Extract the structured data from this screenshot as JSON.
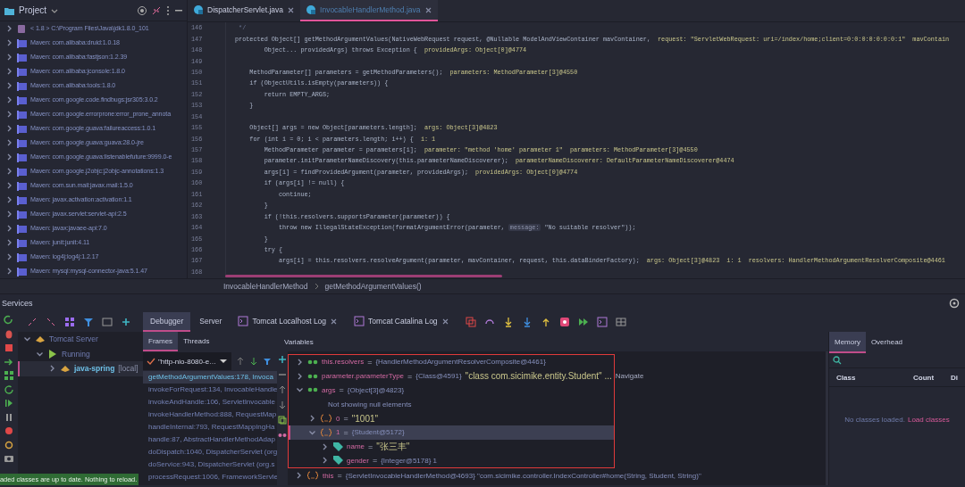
{
  "project": {
    "title": "Project",
    "items": [
      {
        "label": "< 1.8 > C:\\Program Files\\Java\\jdk1.8.0_101",
        "kind": "sdk",
        "expanded": false
      },
      {
        "label": "Maven: com.alibaba:druid:1.0.18",
        "kind": "library",
        "expanded": false
      },
      {
        "label": "Maven: com.alibaba:fastjson:1.2.39",
        "kind": "library",
        "expanded": false
      },
      {
        "label": "Maven: com.alibaba:jconsole:1.8.0",
        "kind": "library",
        "expanded": false
      },
      {
        "label": "Maven: com.alibaba:tools:1.8.0",
        "kind": "library",
        "expanded": false
      },
      {
        "label": "Maven: com.google.code.findbugs:jsr305:3.0.2",
        "kind": "library",
        "expanded": false
      },
      {
        "label": "Maven: com.google.errorprone:error_prone_annota",
        "kind": "library",
        "expanded": false
      },
      {
        "label": "Maven: com.google.guava:failureaccess:1.0.1",
        "kind": "library",
        "expanded": false
      },
      {
        "label": "Maven: com.google.guava:guava:28.0-jre",
        "kind": "library",
        "expanded": false
      },
      {
        "label": "Maven: com.google.guava:listenablefuture:9999.0-e",
        "kind": "library",
        "expanded": false
      },
      {
        "label": "Maven: com.google.j2objc:j2objc-annotations:1.3",
        "kind": "library",
        "expanded": false
      },
      {
        "label": "Maven: com.sun.mail:javax.mail:1.5.0",
        "kind": "library",
        "expanded": false
      },
      {
        "label": "Maven: javax.activation:activation:1.1",
        "kind": "library",
        "expanded": false
      },
      {
        "label": "Maven: javax.servlet:servlet-api:2.5",
        "kind": "library",
        "expanded": false
      },
      {
        "label": "Maven: javax:javaee-api:7.0",
        "kind": "library",
        "expanded": false
      },
      {
        "label": "Maven: junit:junit:4.11",
        "kind": "library",
        "expanded": false
      },
      {
        "label": "Maven: log4j:log4j:1.2.17",
        "kind": "library",
        "expanded": false
      },
      {
        "label": "Maven: mysql:mysql-connector-java:5.1.47",
        "kind": "library",
        "expanded": false
      }
    ]
  },
  "editor": {
    "tabs": [
      {
        "label": "DispatcherServlet.java",
        "selected": false
      },
      {
        "label": "InvocableHandlerMethod.java",
        "selected": true
      }
    ],
    "lines": [
      {
        "number": "146",
        "parts": [
          {
            "kind": "comment",
            "text": " */"
          }
        ]
      },
      {
        "number": "147",
        "parts": [
          {
            "kind": "code",
            "text": "protected Object[] getMethodArgumentValues(NativeWebRequest request, @Nullable ModelAndViewContainer mavContainer,"
          },
          {
            "kind": "hint",
            "text": "request: \"ServletWebRequest: uri=/index/home;client=0:0:0:0:0:0:0:1\""
          },
          {
            "kind": "hint",
            "text": "mavContain"
          }
        ]
      },
      {
        "number": "148",
        "parts": [
          {
            "kind": "code",
            "text": "        Object... providedArgs) throws Exception {"
          },
          {
            "kind": "hint",
            "text": "providedArgs: Object[0]@4774"
          }
        ]
      },
      {
        "number": "149"
      },
      {
        "number": "150",
        "parts": [
          {
            "kind": "code",
            "text": "    MethodParameter[] parameters = getMethodParameters();"
          },
          {
            "kind": "hint",
            "text": "parameters: MethodParameter[3]@4550"
          }
        ]
      },
      {
        "number": "151",
        "parts": [
          {
            "kind": "code",
            "text": "    if (ObjectUtils.isEmpty(parameters)) {"
          }
        ]
      },
      {
        "number": "152",
        "parts": [
          {
            "kind": "code",
            "text": "        return EMPTY_ARGS;"
          }
        ]
      },
      {
        "number": "153",
        "parts": [
          {
            "kind": "code",
            "text": "    }"
          }
        ]
      },
      {
        "number": "154"
      },
      {
        "number": "155",
        "parts": [
          {
            "kind": "code",
            "text": "    Object[] args = new Object[parameters.length];"
          },
          {
            "kind": "hint",
            "text": "args: Object[3]@4823"
          }
        ]
      },
      {
        "number": "156",
        "parts": [
          {
            "kind": "code",
            "text": "    for (int i = 0; i < parameters.length; i++) {"
          },
          {
            "kind": "hint",
            "text": "i: 1"
          }
        ]
      },
      {
        "number": "157",
        "parts": [
          {
            "kind": "code",
            "text": "        MethodParameter parameter = parameters[i];"
          },
          {
            "kind": "hint",
            "text": "parameter: \"method 'home' parameter 1\""
          },
          {
            "kind": "hint",
            "text": "parameters: MethodParameter[3]@4550"
          }
        ]
      },
      {
        "number": "158",
        "parts": [
          {
            "kind": "code",
            "text": "        parameter.initParameterNameDiscovery(this.parameterNameDiscoverer);"
          },
          {
            "kind": "hint",
            "text": "parameterNameDiscoverer: DefaultParameterNameDiscoverer@4474"
          }
        ]
      },
      {
        "number": "159",
        "parts": [
          {
            "kind": "code",
            "text": "        args[i] = findProvidedArgument(parameter, providedArgs);"
          },
          {
            "kind": "hint",
            "text": "providedArgs: Object[0]@4774"
          }
        ]
      },
      {
        "number": "160",
        "parts": [
          {
            "kind": "code",
            "text": "        if (args[i] != null) {"
          }
        ]
      },
      {
        "number": "161",
        "parts": [
          {
            "kind": "code",
            "text": "            continue;"
          }
        ]
      },
      {
        "number": "162",
        "parts": [
          {
            "kind": "code",
            "text": "        }"
          }
        ]
      },
      {
        "number": "163",
        "parts": [
          {
            "kind": "code",
            "text": "        if (!this.resolvers.supportsParameter(parameter)) {"
          }
        ]
      },
      {
        "number": "164",
        "parts": [
          {
            "kind": "code",
            "text": "            throw new IllegalStateException(formatArgumentError(parameter,"
          },
          {
            "kind": "param",
            "text": "message:"
          },
          {
            "kind": "code",
            "text": "\"No suitable resolver\"));"
          }
        ]
      },
      {
        "number": "165",
        "parts": [
          {
            "kind": "code",
            "text": "        }"
          }
        ]
      },
      {
        "number": "166",
        "parts": [
          {
            "kind": "code",
            "text": "        try {"
          }
        ]
      },
      {
        "number": "167",
        "parts": [
          {
            "kind": "code",
            "text": "            args[i] = this.resolvers.resolveArgument(parameter, mavContainer, request, this.dataBinderFactory);"
          },
          {
            "kind": "hint",
            "text": "args: Object[3]@4823"
          },
          {
            "kind": "hint",
            "text": "i: 1"
          },
          {
            "kind": "hint",
            "text": "resolvers: HandlerMethodArgumentResolverComposite@4461"
          }
        ]
      },
      {
        "number": "168"
      }
    ],
    "breadcrumb": [
      "InvocableHandlerMethod",
      "getMethodArgumentValues()"
    ]
  },
  "services": {
    "title": "Services",
    "tree": [
      {
        "label": "Tomcat Server",
        "kind": "server",
        "expanded": true,
        "selected": false,
        "children": [
          {
            "label": "Running",
            "kind": "status",
            "expanded": true,
            "selected": false,
            "children": [
              {
                "label": "java-spring",
                "suffix": "[local]",
                "kind": "app",
                "expanded": false,
                "selected": true
              }
            ]
          }
        ]
      }
    ]
  },
  "debugger": {
    "tabs": [
      {
        "label": "Debugger",
        "selected": true,
        "closable": false,
        "kind": "plain"
      },
      {
        "label": "Server",
        "selected": false,
        "closable": false,
        "kind": "plain"
      },
      {
        "label": "Tomcat Localhost Log",
        "selected": false,
        "closable": true,
        "kind": "log"
      },
      {
        "label": "Tomcat Catalina Log",
        "selected": false,
        "closable": true,
        "kind": "log"
      }
    ],
    "subtabs": [
      {
        "label": "Frames",
        "selected": true
      },
      {
        "label": "Threads",
        "selected": false
      }
    ],
    "variables_title": "Variables",
    "thread": "\"http-nio-8080-e…",
    "frames": [
      {
        "label": "getMethodArgumentValues:178, Invoca",
        "selected": true
      },
      {
        "label": "invokeForRequest:134, InvocableHandle",
        "selected": false
      },
      {
        "label": "invokeAndHandle:106, ServletInvocable",
        "selected": false
      },
      {
        "label": "invokeHandlerMethod:888, RequestMap",
        "selected": false
      },
      {
        "label": "handleInternal:793, RequestMappingHa",
        "selected": false
      },
      {
        "label": "handle:87, AbstractHandlerMethodAdap",
        "selected": false
      },
      {
        "label": "doDispatch:1040, DispatcherServlet (org",
        "selected": false
      },
      {
        "label": "doService:943, DispatcherServlet (org.s",
        "selected": false
      },
      {
        "label": "processRequest:1006, FrameworkServle",
        "selected": false
      }
    ],
    "variables": [
      {
        "kind": "watch",
        "name": "this.resolvers",
        "eq": "=",
        "value": "{HandlerMethodArgumentResolverComposite@4461}",
        "expanded": false,
        "selected": false,
        "highlighted": true
      },
      {
        "kind": "watch",
        "name": "parameter.parameterType",
        "eq": "=",
        "value": "{Class@4591}",
        "string": "\"class com.sicimike.entity.Student\" ...",
        "link": "Navigate",
        "expanded": false,
        "selected": false,
        "highlighted": true
      },
      {
        "kind": "watch",
        "name": "args",
        "eq": "=",
        "value": "{Object[3]@4823}",
        "expanded": true,
        "selected": false,
        "highlighted": true,
        "children": [
          {
            "kind": "message",
            "text": "Not showing null elements"
          },
          {
            "kind": "element",
            "name": "0",
            "eq": "=",
            "string": "\"1001\"",
            "expanded": false,
            "selected": false
          },
          {
            "kind": "element",
            "name": "1",
            "eq": "=",
            "value": "{Student@5172}",
            "expanded": true,
            "selected": true,
            "children": [
              {
                "kind": "field",
                "name": "name",
                "eq": "=",
                "string": "\"张三丰\"",
                "expanded": false,
                "selected": false
              },
              {
                "kind": "field",
                "name": "gender",
                "eq": "=",
                "value": "{Integer@5178} 1",
                "expanded": false,
                "selected": false
              }
            ]
          }
        ]
      },
      {
        "kind": "element",
        "name": "this",
        "eq": "=",
        "value": "{ServletInvocableHandlerMethod@4693} \"com.sicimike.controller.IndexController#home(String, Student, String)\"",
        "expanded": false,
        "selected": false,
        "highlighted": false
      }
    ]
  },
  "memory": {
    "tabs": [
      {
        "label": "Memory",
        "selected": true
      },
      {
        "label": "Overhead",
        "selected": false
      }
    ],
    "columns": [
      "Class",
      "Count",
      "Di"
    ],
    "empty_text": "No classes loaded.",
    "link": "Load classes"
  },
  "notification": "aded classes are up to date. Nothing to reload."
}
